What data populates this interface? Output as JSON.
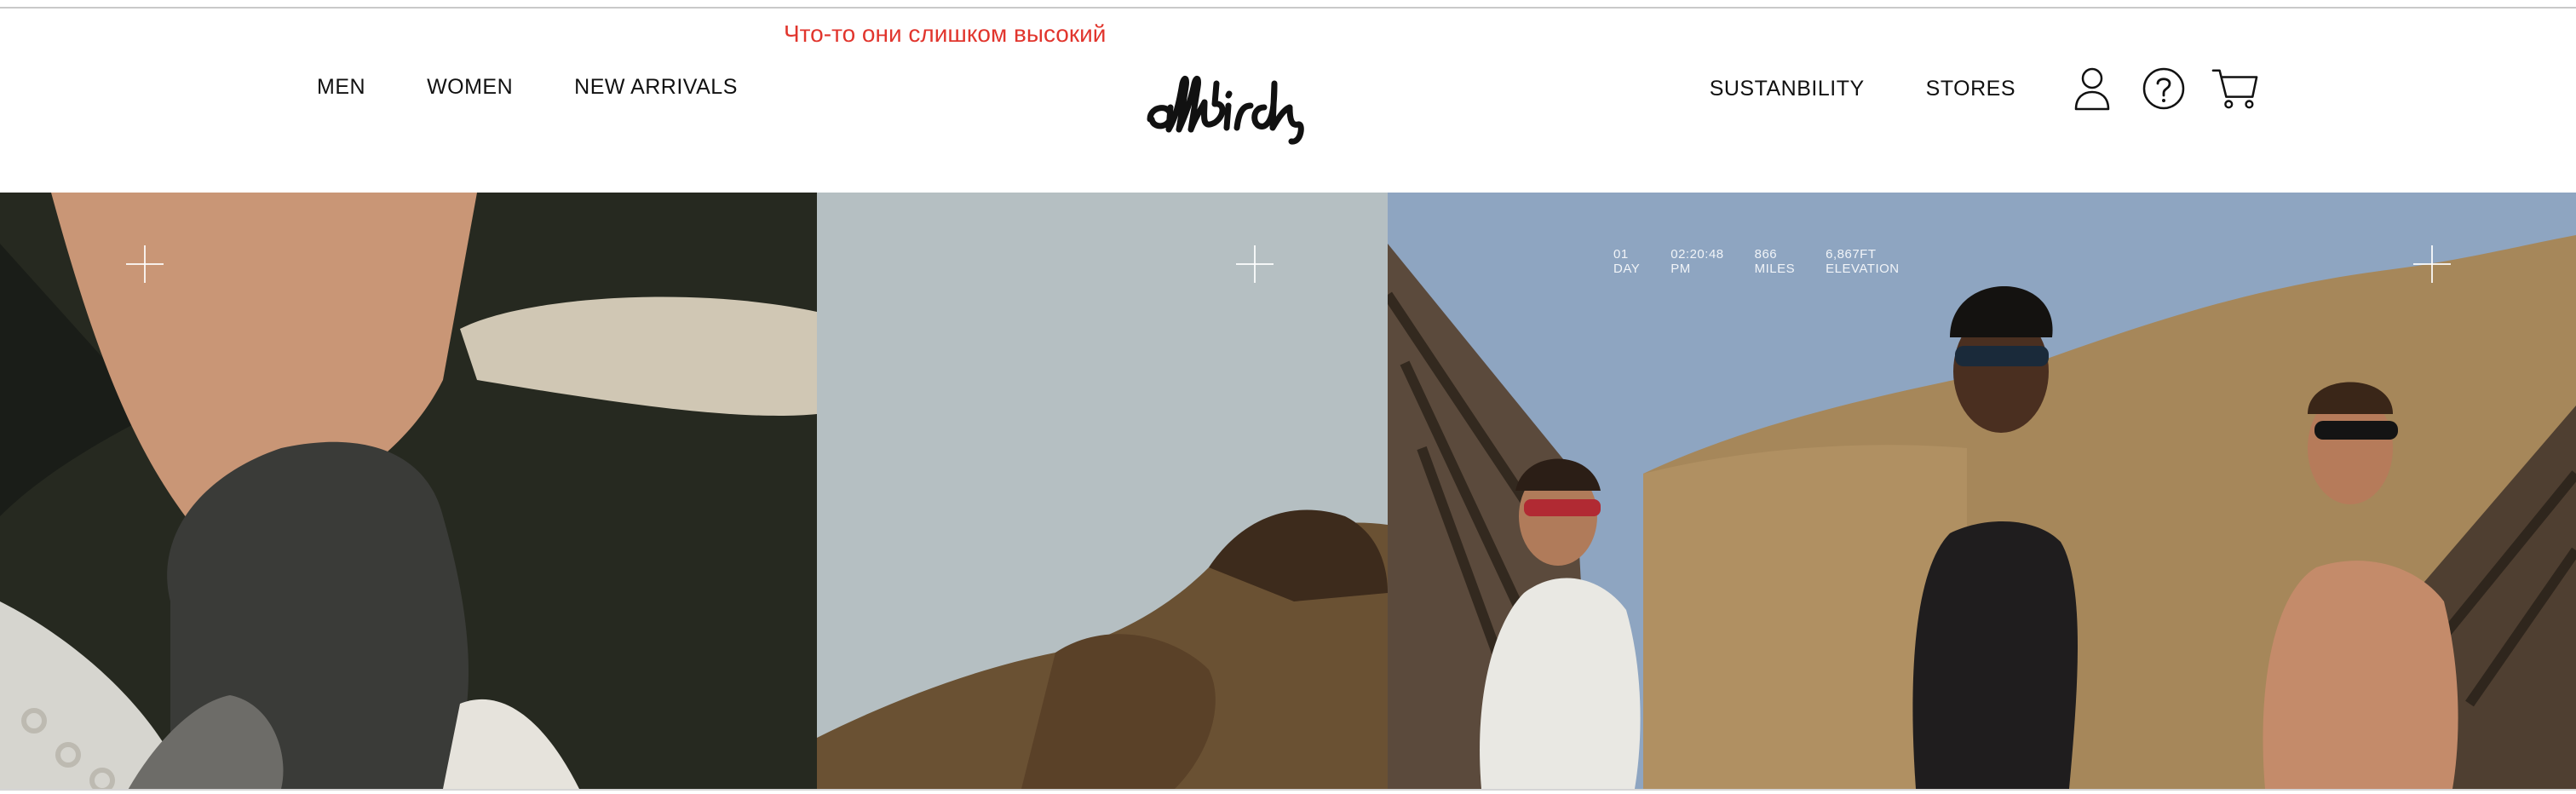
{
  "annotation": "Что-то они слишком высокий",
  "nav": {
    "left": [
      "MEN",
      "WOMEN",
      "NEW ARRIVALS"
    ],
    "right": [
      "SUSTANBILITY",
      "STORES"
    ]
  },
  "logo": "allbirds",
  "icons": {
    "account": "account-icon",
    "help": "help-icon",
    "cart": "cart-icon"
  },
  "hero": {
    "stats": [
      {
        "value": "01",
        "label": "DAY"
      },
      {
        "value": "02:20:48",
        "label": "PM"
      },
      {
        "value": "866",
        "label": "MILES"
      },
      {
        "value": "6,867FT",
        "label": "ELEVATION"
      }
    ]
  }
}
